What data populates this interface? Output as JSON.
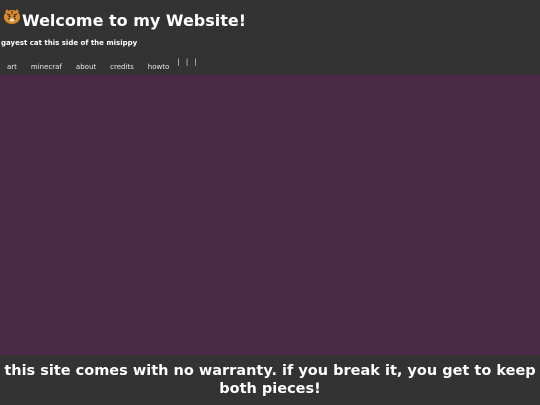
{
  "header": {
    "title": "Welcome to my Website!",
    "tagline": "gayest cat this side of the misippy",
    "logo_icon": "tiger-icon"
  },
  "nav": {
    "items": [
      {
        "label": "art"
      },
      {
        "label": "minecraf"
      },
      {
        "label": "about"
      },
      {
        "label": "credits"
      },
      {
        "label": "howto"
      }
    ],
    "extra": "| | |"
  },
  "footer": {
    "text": "this site comes with no warranty. if you break it, you get to keep both pieces!"
  },
  "colors": {
    "header_bg": "#333333",
    "main_bg": "#4a2a45",
    "text": "#ffffff"
  }
}
